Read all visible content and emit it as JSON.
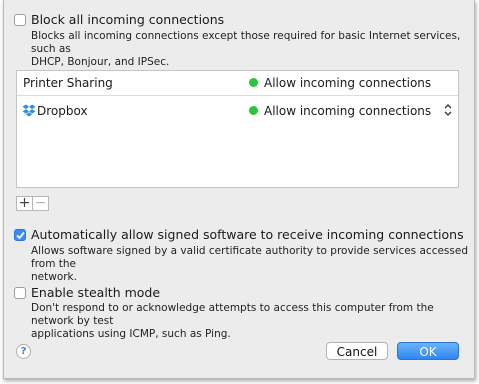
{
  "block_all": {
    "label": "Block all incoming connections",
    "checked": false,
    "description_line1": "Blocks all incoming connections except those required for basic Internet services,  such as",
    "description_line2": "DHCP, Bonjour, and IPSec."
  },
  "apps": [
    {
      "name": "Printer Sharing",
      "status": "Allow incoming connections",
      "status_color": "#2bc53b",
      "has_stepper": false
    },
    {
      "name": "Dropbox",
      "icon": "dropbox-icon",
      "status": "Allow incoming connections",
      "status_color": "#2bc53b",
      "has_stepper": true
    }
  ],
  "list_controls": {
    "add_label": "+",
    "remove_label": "−"
  },
  "signed_software": {
    "label": "Automatically allow signed software to receive incoming connections",
    "checked": true,
    "description_line1": "Allows software signed by a valid certificate authority to provide services accessed from the",
    "description_line2": "network."
  },
  "stealth_mode": {
    "label": "Enable stealth mode",
    "checked": false,
    "description_line1": "Don't respond to or acknowledge attempts to access this computer from the network by test",
    "description_line2": "applications using ICMP, such as Ping."
  },
  "footer": {
    "help_label": "?",
    "cancel_label": "Cancel",
    "ok_label": "OK"
  },
  "colors": {
    "accent": "#3b8df5",
    "status_green": "#2bc53b",
    "dropbox_blue": "#2f8fe0"
  }
}
